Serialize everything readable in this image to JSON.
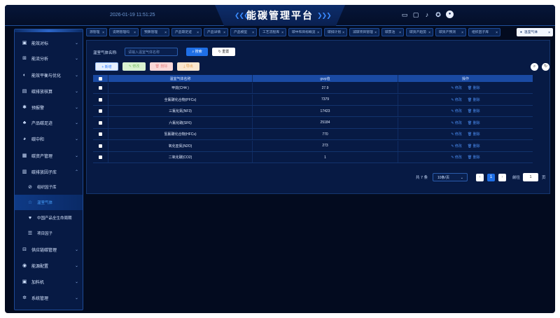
{
  "header": {
    "time": "2026-01-19 11:51:25",
    "title": "能碳管理平台",
    "arrows_left": "❮❮❮",
    "arrows_right": "❯❯❯",
    "icons": [
      "monitor-icon",
      "desktop-icon",
      "bell-icon",
      "badge-icon",
      "avatar"
    ]
  },
  "sidebar": {
    "items": [
      {
        "label": "能效对标",
        "icon": "▣",
        "chevron": "⌄"
      },
      {
        "label": "能流分析",
        "icon": "⊞",
        "chevron": "⌄"
      },
      {
        "label": "能效平衡与优化",
        "icon": "◐",
        "chevron": "⌄"
      },
      {
        "label": "碳排放核算",
        "icon": "▤",
        "chevron": "⌄"
      },
      {
        "label": "预报警",
        "icon": "✱",
        "chevron": "⌄"
      },
      {
        "label": "产品碳足迹",
        "icon": "♣",
        "chevron": "⌄"
      },
      {
        "label": "碳中和",
        "icon": "◕",
        "chevron": "⌄"
      },
      {
        "label": "碳资产管理",
        "icon": "▦",
        "chevron": "⌄"
      },
      {
        "label": "碳排放因子库",
        "icon": "▥",
        "chevron": "⌃"
      },
      {
        "label": "组织因子库",
        "icon": "⊘",
        "chevron": ""
      },
      {
        "label": "温室气体",
        "icon": "☆",
        "chevron": ""
      },
      {
        "label": "中国产品全生命周期",
        "icon": "♥",
        "chevron": ""
      },
      {
        "label": "项目因子",
        "icon": "☰",
        "chevron": ""
      },
      {
        "label": "供应链碳管理",
        "icon": "⊟",
        "chevron": "⌄"
      },
      {
        "label": "能源配置",
        "icon": "◉",
        "chevron": "⌄"
      },
      {
        "label": "加料机",
        "icon": "▣",
        "chevron": "⌄"
      },
      {
        "label": "系统管理",
        "icon": "✲",
        "chevron": "⌄"
      }
    ]
  },
  "tabs": [
    {
      "label": "源管理",
      "close": "×"
    },
    {
      "label": "说明管理吗",
      "close": "×"
    },
    {
      "label": "预算管理",
      "close": "×"
    },
    {
      "label": "产品碳足迹",
      "close": "×"
    },
    {
      "label": "产品详情",
      "close": "×"
    },
    {
      "label": "产品模型",
      "close": "×"
    },
    {
      "label": "工艺流程库",
      "close": "×"
    },
    {
      "label": "碳中和目标概览",
      "close": "×"
    },
    {
      "label": "碳排计划",
      "close": "×"
    },
    {
      "label": "减碳项目管理",
      "close": "×"
    },
    {
      "label": "碳票池",
      "close": "×"
    },
    {
      "label": "碳资产趋势",
      "close": "×"
    },
    {
      "label": "碳资产预测",
      "close": "×"
    },
    {
      "label": "组织因子库",
      "close": "×"
    },
    {
      "label": "温室气体",
      "close": "×",
      "dot": "●"
    }
  ],
  "filter": {
    "label": "温室气体名称:",
    "placeholder": "请输入温室气体名称",
    "search_label": "⌕ 搜索",
    "reset_label": "↻ 重置"
  },
  "toolbar": {
    "add_label": "+ 新增",
    "edit_label": "✎ 修改",
    "delete_label": "🗑 删除",
    "export_label": "⤓ 导出",
    "search_toggle": "⌕",
    "refresh": "↻"
  },
  "table": {
    "headers": [
      "",
      "温室气体名称",
      "gwp值",
      "操作"
    ],
    "rows": [
      {
        "name": "甲烷(CH4 )",
        "gwp": "27.9"
      },
      {
        "name": "全氟碳化合物(PFCs)",
        "gwp": "7379"
      },
      {
        "name": "三氟化氮(NF3)",
        "gwp": "17423"
      },
      {
        "name": "六氟化硫(SF6)",
        "gwp": "25184"
      },
      {
        "name": "氢氟碳化合物(HFCs)",
        "gwp": "770"
      },
      {
        "name": "氧化亚氮(N2O)",
        "gwp": "273"
      },
      {
        "name": "二氧化碳(CO2)",
        "gwp": "1"
      }
    ],
    "edit_label": "✎ 修改",
    "delete_label": "🗑 删除"
  },
  "pagination": {
    "total": "共 7 条",
    "page_size": "10条/页",
    "size_chevron": "⌄",
    "prev": "‹",
    "current": "1",
    "next": "›",
    "goto_label": "前往",
    "goto_value": "1",
    "page_suffix": "页"
  }
}
